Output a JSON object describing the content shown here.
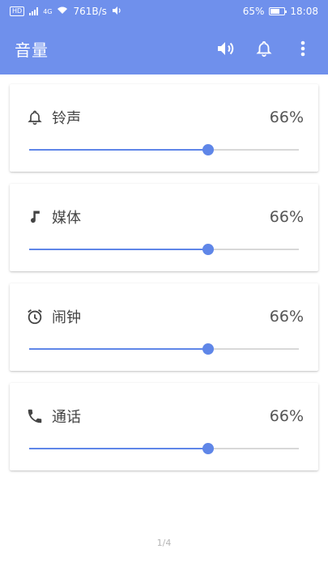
{
  "status_bar": {
    "hd": "HD",
    "net": "4G",
    "speed": "761B/s",
    "battery": "65%",
    "battery_level": 0.65,
    "time": "18:08"
  },
  "app_bar": {
    "title": "音量",
    "actions": [
      "speaker-icon",
      "bell-icon",
      "more-vert-icon"
    ]
  },
  "colors": {
    "accent": "#6f90ec",
    "slider": "#5f86e8",
    "track": "#d8d8d8"
  },
  "volumes": [
    {
      "label": "铃声",
      "value": "66%",
      "level": 0.665,
      "icon": "bell-icon"
    },
    {
      "label": "媒体",
      "value": "66%",
      "level": 0.665,
      "icon": "music-note-icon"
    },
    {
      "label": "闹钟",
      "value": "66%",
      "level": 0.665,
      "icon": "alarm-clock-icon"
    },
    {
      "label": "通话",
      "value": "66%",
      "level": 0.665,
      "icon": "phone-icon"
    }
  ],
  "pager": "1/4"
}
